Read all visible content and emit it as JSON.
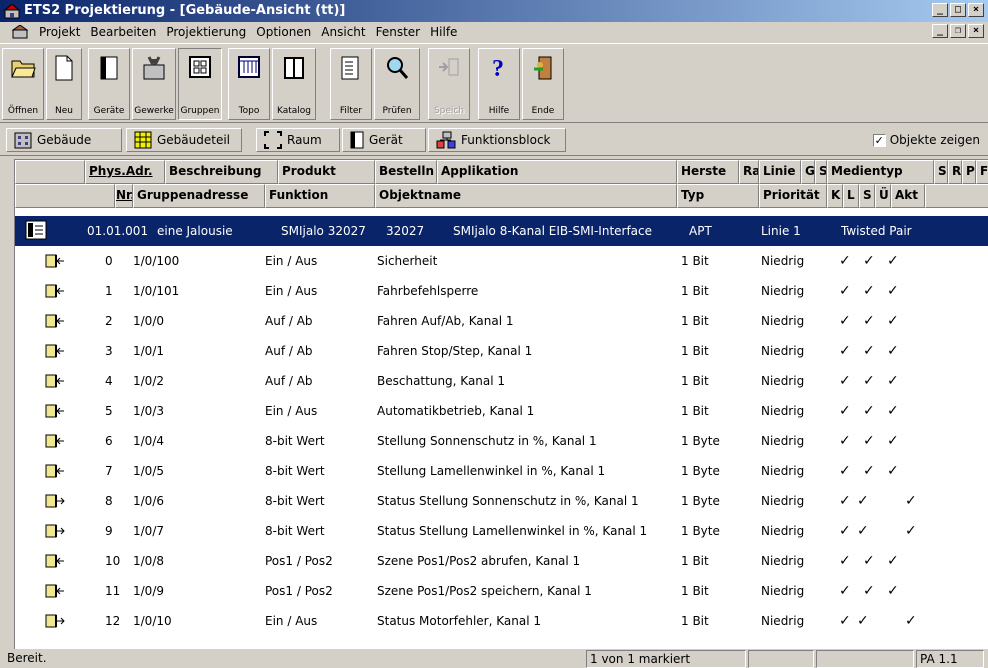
{
  "window": {
    "title": "ETS2 Projektierung - [Gebäude-Ansicht (tt)]"
  },
  "menu": [
    {
      "label": "Projekt"
    },
    {
      "label": "Bearbeiten"
    },
    {
      "label": "Projektierung"
    },
    {
      "label": "Optionen"
    },
    {
      "label": "Ansicht"
    },
    {
      "label": "Fenster"
    },
    {
      "label": "Hilfe"
    }
  ],
  "toolbar": {
    "buttons": [
      "Öffnen",
      "Neu",
      "Geräte",
      "Gewerke",
      "Gruppen",
      "Topo",
      "Katalog",
      "Filter",
      "Prüfen",
      "Speich",
      "Hilfe",
      "Ende"
    ]
  },
  "viewbar": {
    "buttons": [
      "Gebäude",
      "Gebäudeteil",
      "Raum",
      "Gerät",
      "Funktionsblock"
    ],
    "checkbox_label": "Objekte zeigen",
    "checkbox_checked": true,
    "checkbox_mark": "✓"
  },
  "grid": {
    "header1": [
      "Phys.Adr.",
      "Beschreibung",
      "Produkt",
      "Bestelln",
      "Applikation",
      "Herste",
      "Ra",
      "Linie",
      "G",
      "S",
      "Medientyp",
      "S",
      "R",
      "P",
      "F"
    ],
    "header2": [
      "Nr.",
      "Gruppenadresse",
      "Funktion",
      "Objektname",
      "Typ",
      "Priorität",
      "K",
      "L",
      "S",
      "Ü",
      "Akt"
    ],
    "device": {
      "phys_adr": "01.01.001",
      "beschreibung": "eine Jalousie",
      "produkt": "SMIjalo 32027",
      "bestelln": "32027",
      "applikation": "SMIjalo 8-Kanal EIB-SMI-Interface",
      "hersteller": "APT",
      "linie": "Linie 1",
      "medientyp": "Twisted Pair"
    },
    "check_mark": "✓",
    "objects": [
      {
        "nr": "0",
        "ga": "1/0/100",
        "funktion": "Ein / Aus",
        "objektname": "Sicherheit",
        "typ": "1 Bit",
        "prio": "Niedrig",
        "flags": [
          1,
          1,
          0,
          1,
          0
        ],
        "dir": "in"
      },
      {
        "nr": "1",
        "ga": "1/0/101",
        "funktion": "Ein / Aus",
        "objektname": "Fahrbefehlsperre",
        "typ": "1 Bit",
        "prio": "Niedrig",
        "flags": [
          1,
          1,
          0,
          1,
          0
        ],
        "dir": "in"
      },
      {
        "nr": "2",
        "ga": "1/0/0",
        "funktion": "Auf / Ab",
        "objektname": "Fahren Auf/Ab, Kanal 1",
        "typ": "1 Bit",
        "prio": "Niedrig",
        "flags": [
          1,
          1,
          0,
          1,
          0
        ],
        "dir": "in"
      },
      {
        "nr": "3",
        "ga": "1/0/1",
        "funktion": "Auf / Ab",
        "objektname": "Fahren Stop/Step, Kanal 1",
        "typ": "1 Bit",
        "prio": "Niedrig",
        "flags": [
          1,
          1,
          0,
          1,
          0
        ],
        "dir": "in"
      },
      {
        "nr": "4",
        "ga": "1/0/2",
        "funktion": "Auf / Ab",
        "objektname": "Beschattung, Kanal 1",
        "typ": "1 Bit",
        "prio": "Niedrig",
        "flags": [
          1,
          1,
          0,
          1,
          0
        ],
        "dir": "in"
      },
      {
        "nr": "5",
        "ga": "1/0/3",
        "funktion": "Ein / Aus",
        "objektname": "Automatikbetrieb, Kanal 1",
        "typ": "1 Bit",
        "prio": "Niedrig",
        "flags": [
          1,
          1,
          0,
          1,
          0
        ],
        "dir": "in"
      },
      {
        "nr": "6",
        "ga": "1/0/4",
        "funktion": "8-bit Wert",
        "objektname": "Stellung Sonnenschutz in %, Kanal 1",
        "typ": "1 Byte",
        "prio": "Niedrig",
        "flags": [
          1,
          1,
          0,
          1,
          0
        ],
        "dir": "in"
      },
      {
        "nr": "7",
        "ga": "1/0/5",
        "funktion": "8-bit Wert",
        "objektname": "Stellung Lamellenwinkel in %, Kanal 1",
        "typ": "1 Byte",
        "prio": "Niedrig",
        "flags": [
          1,
          1,
          0,
          1,
          0
        ],
        "dir": "in"
      },
      {
        "nr": "8",
        "ga": "1/0/6",
        "funktion": "8-bit Wert",
        "objektname": "Status Stellung Sonnenschutz in %, Kanal 1",
        "typ": "1 Byte",
        "prio": "Niedrig",
        "flags": [
          1,
          1,
          1,
          0,
          0
        ],
        "dir": "out"
      },
      {
        "nr": "9",
        "ga": "1/0/7",
        "funktion": "8-bit Wert",
        "objektname": "Status Stellung Lamellenwinkel in %, Kanal 1",
        "typ": "1 Byte",
        "prio": "Niedrig",
        "flags": [
          1,
          1,
          1,
          0,
          0
        ],
        "dir": "out"
      },
      {
        "nr": "10",
        "ga": "1/0/8",
        "funktion": "Pos1 / Pos2",
        "objektname": "Szene Pos1/Pos2 abrufen, Kanal 1",
        "typ": "1 Bit",
        "prio": "Niedrig",
        "flags": [
          1,
          1,
          0,
          1,
          0
        ],
        "dir": "in"
      },
      {
        "nr": "11",
        "ga": "1/0/9",
        "funktion": "Pos1 / Pos2",
        "objektname": "Szene Pos1/Pos2 speichern, Kanal 1",
        "typ": "1 Bit",
        "prio": "Niedrig",
        "flags": [
          1,
          1,
          0,
          1,
          0
        ],
        "dir": "in"
      },
      {
        "nr": "12",
        "ga": "1/0/10",
        "funktion": "Ein / Aus",
        "objektname": "Status Motorfehler, Kanal 1",
        "typ": "1 Bit",
        "prio": "Niedrig",
        "flags": [
          1,
          1,
          1,
          0,
          0
        ],
        "dir": "out"
      }
    ]
  },
  "statusbar": {
    "status": "Bereit.",
    "selection": "1 von 1 markiert",
    "address": "PA 1.1"
  },
  "colors": {
    "selection": "#0a246a",
    "window_bg": "#d4d0c8",
    "title_gradient_end": "#a6caf0"
  }
}
